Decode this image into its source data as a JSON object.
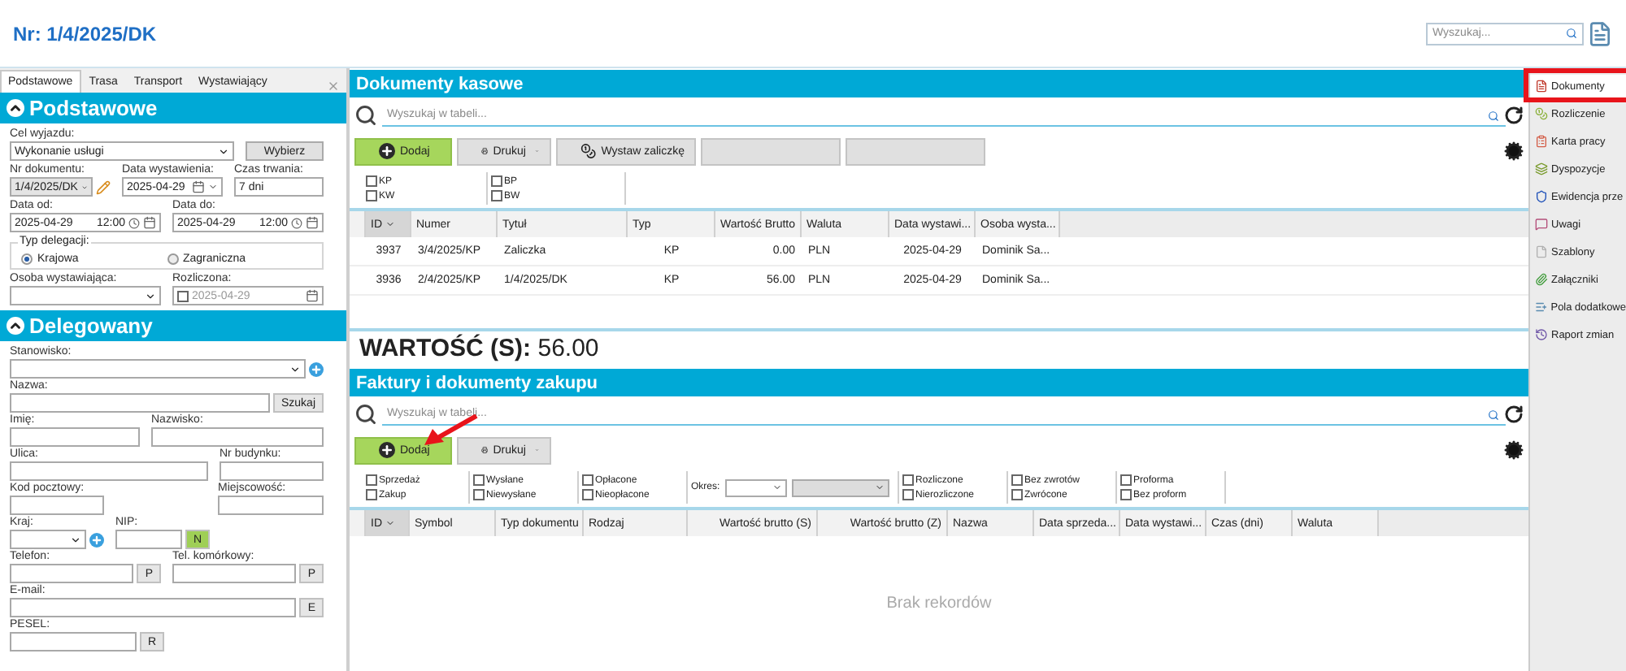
{
  "header": {
    "title": "Nr: 1/4/2025/DK",
    "search_placeholder": "Wyszukaj..."
  },
  "tabs": [
    {
      "label": "Podstawowe",
      "selected": true
    },
    {
      "label": "Trasa",
      "selected": false
    },
    {
      "label": "Transport",
      "selected": false
    },
    {
      "label": "Wystawiający",
      "selected": false
    }
  ],
  "sections": [
    {
      "title": "Podstawowe",
      "expanded": true,
      "rows": [
        [
          {
            "kind": "select",
            "label": "Cel wyjazdu:",
            "value": "Wykonanie usługi"
          },
          {
            "kind": "button",
            "label": "Wybierz"
          }
        ],
        [
          {
            "kind": "doc",
            "label": "Nr dokumentu:",
            "value": "1/4/2025/DK",
            "disabled": true
          },
          {
            "kind": "date",
            "label": "Data wystawienia:",
            "value": "2025-04-29"
          },
          {
            "kind": "text",
            "label": "Czas trwania:",
            "value": "7 dni"
          }
        ],
        [
          {
            "kind": "datetime",
            "label": "Data od:",
            "value": "2025-04-29",
            "time": "12:00"
          },
          {
            "kind": "datetime",
            "label": "Data do:",
            "value": "2025-04-29",
            "time": "12:00"
          }
        ],
        [
          {
            "kind": "radios",
            "label": "Typ delegacji:",
            "options": [
              {
                "label": "Krajowa",
                "selected": true
              },
              {
                "label": "Zagraniczna",
                "selected": false
              }
            ]
          }
        ],
        [
          {
            "kind": "select",
            "label": "Osoba wystawiająca:"
          },
          {
            "kind": "checkdate",
            "label": "Rozliczona:",
            "value": "2025-04-29",
            "checked": false
          }
        ]
      ]
    },
    {
      "title": "Delegowany",
      "expanded": true,
      "rows": [
        [
          {
            "kind": "select",
            "label": "Stanowisko:",
            "plus": true
          }
        ],
        [
          {
            "kind": "text",
            "label": "Nazwa:",
            "suffix": {
              "label": "Szukaj",
              "kind": "plain"
            }
          }
        ],
        [
          {
            "kind": "text",
            "label": "Imię:"
          },
          {
            "kind": "text",
            "label": "Nazwisko:"
          }
        ],
        [
          {
            "kind": "text",
            "label": "Ulica:"
          },
          {
            "kind": "text",
            "label": "Nr budynku:"
          }
        ],
        [
          {
            "kind": "text",
            "label": "Kod pocztowy:"
          },
          {
            "kind": "text",
            "label": "Miejscowość:"
          }
        ],
        [
          {
            "kind": "select",
            "label": "Kraj:",
            "plus": true
          },
          {
            "kind": "text",
            "label": "NIP:",
            "suffix": {
              "label": "N",
              "kind": "validate"
            }
          }
        ],
        [
          {
            "kind": "text",
            "label": "Telefon:",
            "suffix": {
              "label": "P",
              "kind": "plain"
            }
          },
          {
            "kind": "text",
            "label": "Tel. komórkowy:",
            "suffix": {
              "label": "P",
              "kind": "plain"
            }
          }
        ],
        [
          {
            "kind": "text",
            "label": "E-mail:",
            "suffix": {
              "label": "E",
              "kind": "plain"
            }
          }
        ],
        [
          {
            "kind": "text",
            "label": "PESEL:",
            "suffix": {
              "label": "R",
              "kind": "plain"
            }
          }
        ]
      ]
    }
  ],
  "panels": [
    {
      "title": "Dokumenty kasowe",
      "search_placeholder": "Wyszukaj w tabeli...",
      "buttons": [
        {
          "kind": "add",
          "label": "Dodaj",
          "pointed": false
        },
        {
          "kind": "print",
          "label": "Drukuj"
        },
        {
          "kind": "issue",
          "label": "Wystaw zaliczkę"
        },
        {
          "kind": "blank"
        },
        {
          "kind": "blank"
        }
      ],
      "filters": [
        {
          "kind": "checks",
          "items": [
            {
              "label": "KP",
              "checked": false
            },
            {
              "label": "KW",
              "checked": false
            }
          ]
        },
        {
          "kind": "checks",
          "items": [
            {
              "label": "BP",
              "checked": false
            },
            {
              "label": "BW",
              "checked": false
            }
          ]
        }
      ],
      "columns": [
        {
          "label": "ID",
          "kind": "id",
          "sorted": true
        },
        {
          "label": "Numer",
          "kind": "text",
          "sorted": false
        },
        {
          "label": "Tytuł",
          "kind": "text",
          "sorted": false
        },
        {
          "label": "Typ",
          "kind": "code",
          "sorted": false
        },
        {
          "label": "Wartość Brutto",
          "kind": "amount",
          "sorted": false
        },
        {
          "label": "Waluta",
          "kind": "text",
          "sorted": false
        },
        {
          "label": "Data wystawi...",
          "kind": "date",
          "sorted": false
        },
        {
          "label": "Osoba wysta...",
          "kind": "text",
          "sorted": false
        }
      ],
      "rows": [
        [
          "3937",
          "3/4/2025/KP",
          "Zaliczka",
          "KP",
          "0.00",
          "PLN",
          "2025-04-29",
          "Dominik Sa..."
        ],
        [
          "3936",
          "2/4/2025/KP",
          "1/4/2025/DK",
          "KP",
          "56.00",
          "PLN",
          "2025-04-29",
          "Dominik Sa..."
        ]
      ],
      "total": "**WARTOŚĆ (S):** 56.00"
    },
    {
      "title": "Faktury i dokumenty zakupu",
      "search_placeholder": "Wyszukaj w tabeli...",
      "buttons": [
        {
          "kind": "add",
          "label": "Dodaj",
          "pointed": true
        },
        {
          "kind": "print",
          "label": "Drukuj"
        }
      ],
      "filters": [
        {
          "kind": "checks",
          "items": [
            {
              "label": "Sprzedaż",
              "checked": false
            },
            {
              "label": "Zakup",
              "checked": false
            }
          ]
        },
        {
          "kind": "checks",
          "items": [
            {
              "label": "Wysłane",
              "checked": false
            },
            {
              "label": "Niewysłane",
              "checked": false
            }
          ]
        },
        {
          "kind": "checks",
          "items": [
            {
              "label": "Opłacone",
              "checked": false
            },
            {
              "label": "Nieopłacone",
              "checked": false
            }
          ]
        },
        {
          "kind": "period",
          "label": "Okres:"
        },
        {
          "kind": "checks",
          "items": [
            {
              "label": "Rozliczone",
              "checked": false
            },
            {
              "label": "Nierozliczone",
              "checked": false
            }
          ]
        },
        {
          "kind": "checks",
          "items": [
            {
              "label": "Bez zwrotów",
              "checked": false
            },
            {
              "label": "Zwrócone",
              "checked": false
            }
          ]
        },
        {
          "kind": "checks",
          "items": [
            {
              "label": "Proforma",
              "checked": false
            },
            {
              "label": "Bez proform",
              "checked": false
            }
          ]
        }
      ],
      "columns": [
        {
          "label": "ID",
          "kind": "id",
          "sorted": true
        },
        {
          "label": "Symbol",
          "kind": "text",
          "sorted": false
        },
        {
          "label": "Typ dokumentu",
          "kind": "text",
          "sorted": false
        },
        {
          "label": "Rodzaj",
          "kind": "text",
          "sorted": false
        },
        {
          "label": "Wartość brutto (S)",
          "kind": "amount",
          "sorted": false
        },
        {
          "label": "Wartość brutto (Z)",
          "kind": "amount",
          "sorted": false
        },
        {
          "label": "Nazwa",
          "kind": "text",
          "sorted": false
        },
        {
          "label": "Data sprzeda...",
          "kind": "date",
          "sorted": false
        },
        {
          "label": "Data wystawi...",
          "kind": "date",
          "sorted": false
        },
        {
          "label": "Czas (dni)",
          "kind": "text",
          "sorted": false
        },
        {
          "label": "Waluta",
          "kind": "text",
          "sorted": false
        }
      ],
      "empty_text": "Brak rekordów"
    }
  ],
  "sidebar": [
    {
      "label": "Dokumenty",
      "selected": true,
      "highlighted": true
    },
    {
      "label": "Rozliczenie",
      "selected": false,
      "highlighted": false
    },
    {
      "label": "Karta pracy",
      "selected": false,
      "highlighted": false
    },
    {
      "label": "Dyspozycje",
      "selected": false,
      "highlighted": false
    },
    {
      "label": "Ewidencja prze",
      "selected": false,
      "highlighted": false
    },
    {
      "label": "Uwagi",
      "selected": false,
      "highlighted": false
    },
    {
      "label": "Szablony",
      "selected": false,
      "highlighted": false
    },
    {
      "label": "Załączniki",
      "selected": false,
      "highlighted": false
    },
    {
      "label": "Pola dodatkowe",
      "selected": false,
      "highlighted": false
    },
    {
      "label": "Raport zmian",
      "selected": false,
      "highlighted": false
    }
  ]
}
